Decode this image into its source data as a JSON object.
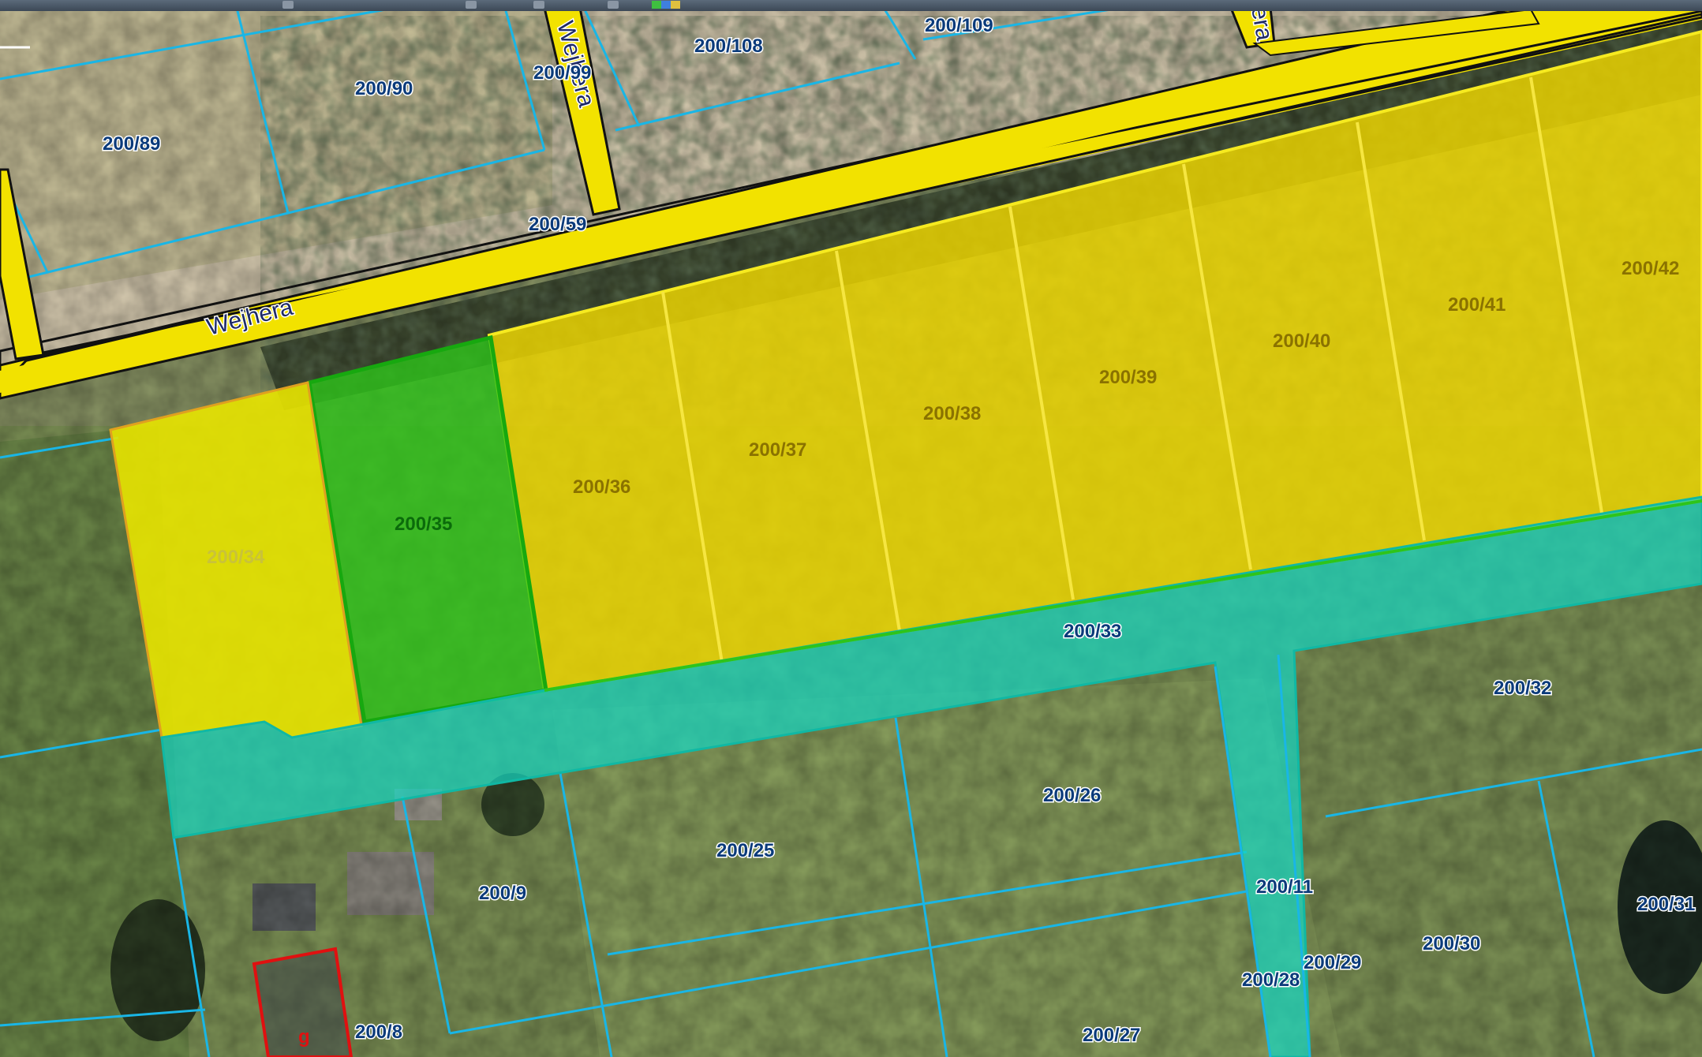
{
  "street_labels": [
    "Wejhera",
    "Wejhera",
    "era"
  ],
  "plots": {
    "p200_34": "200/34",
    "p200_35": "200/35",
    "p200_36": "200/36",
    "p200_37": "200/37",
    "p200_38": "200/38",
    "p200_39": "200/39",
    "p200_40": "200/40",
    "p200_41": "200/41",
    "p200_42": "200/42",
    "p200_33": "200/33",
    "p200_32": "200/32",
    "p200_26": "200/26",
    "p200_25": "200/25",
    "p200_9": "200/9",
    "p200_8": "200/8",
    "p200_11": "200/11",
    "p200_28": "200/28",
    "p200_29": "200/29",
    "p200_30": "200/30",
    "p200_31": "200/31",
    "p200_27": "200/27",
    "p200_59": "200/59",
    "p200_89": "200/89",
    "p200_90": "200/90",
    "p200_99": "200/99",
    "p200_108": "200/108",
    "p200_109": "200/109"
  },
  "building_label": "g",
  "colors": {
    "road": "#f2e200",
    "parcel_line": "#19b6e6",
    "yellow_zone": "#f0d800",
    "green_zone": "#2ec41a",
    "lime_zone": "#e8e400",
    "teal_zone": "#16d6c0",
    "building_outline": "#e01010"
  }
}
